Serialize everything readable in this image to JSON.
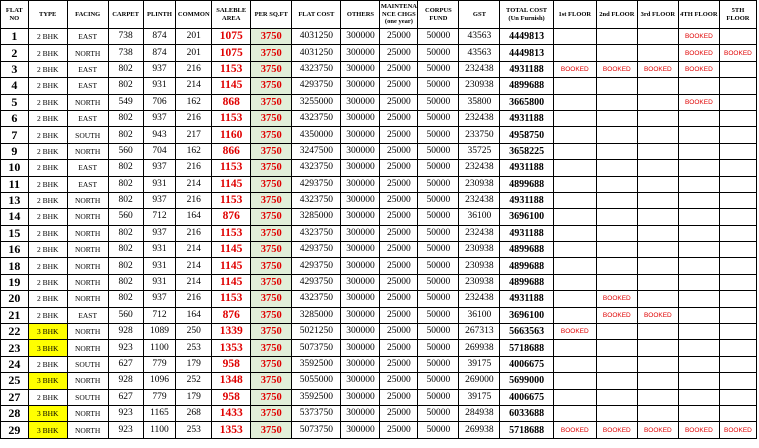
{
  "headers": [
    "FLAT NO",
    "TYPE",
    "FACING",
    "CARPET",
    "PLINTH",
    "COMMON",
    "SALEBLE AREA",
    "PER SQ.FT",
    "FLAT COST",
    "OTHERS",
    "MAINTENA NCE CHGS (one year)",
    "CORPUS FUND",
    "GST",
    "TOTAL COST (Un Furnish)",
    "1st FLOOR",
    "2nd FLOOR",
    "3rd FLOOR",
    "4TH FLOOR",
    "5TH FLOOR"
  ],
  "booked_label": "BOOKED",
  "highlight_color": "#ffff00",
  "rate_column_color": "#e2efd9",
  "accent_red": "#e00000",
  "rows": [
    {
      "flat": "1",
      "type": "2 BHK",
      "facing": "EAST",
      "carpet": "738",
      "plinth": "874",
      "common": "201",
      "saleable": "1075",
      "rate": "3750",
      "flat_cost": "4031250",
      "others": "300000",
      "maint": "25000",
      "corpus": "50000",
      "gst": "43563",
      "total": "4449813",
      "floors": [
        "",
        "",
        "",
        "BOOKED",
        ""
      ]
    },
    {
      "flat": "2",
      "type": "2 BHK",
      "facing": "NORTH",
      "carpet": "738",
      "plinth": "874",
      "common": "201",
      "saleable": "1075",
      "rate": "3750",
      "flat_cost": "4031250",
      "others": "300000",
      "maint": "25000",
      "corpus": "50000",
      "gst": "43563",
      "total": "4449813",
      "floors": [
        "",
        "",
        "",
        "BOOKED",
        "BOOKED"
      ]
    },
    {
      "flat": "3",
      "type": "2 BHK",
      "facing": "EAST",
      "carpet": "802",
      "plinth": "937",
      "common": "216",
      "saleable": "1153",
      "rate": "3750",
      "flat_cost": "4323750",
      "others": "300000",
      "maint": "25000",
      "corpus": "50000",
      "gst": "232438",
      "total": "4931188",
      "floors": [
        "BOOKED",
        "BOOKED",
        "BOOKED",
        "BOOKED",
        ""
      ]
    },
    {
      "flat": "4",
      "type": "2 BHK",
      "facing": "EAST",
      "carpet": "802",
      "plinth": "931",
      "common": "214",
      "saleable": "1145",
      "rate": "3750",
      "flat_cost": "4293750",
      "others": "300000",
      "maint": "25000",
      "corpus": "50000",
      "gst": "230938",
      "total": "4899688",
      "floors": [
        "",
        "",
        "",
        "",
        ""
      ]
    },
    {
      "flat": "5",
      "type": "2 BHK",
      "facing": "NORTH",
      "carpet": "549",
      "plinth": "706",
      "common": "162",
      "saleable": "868",
      "rate": "3750",
      "flat_cost": "3255000",
      "others": "300000",
      "maint": "25000",
      "corpus": "50000",
      "gst": "35800",
      "total": "3665800",
      "floors": [
        "",
        "",
        "",
        "BOOKED",
        ""
      ]
    },
    {
      "flat": "6",
      "type": "2 BHK",
      "facing": "EAST",
      "carpet": "802",
      "plinth": "937",
      "common": "216",
      "saleable": "1153",
      "rate": "3750",
      "flat_cost": "4323750",
      "others": "300000",
      "maint": "25000",
      "corpus": "50000",
      "gst": "232438",
      "total": "4931188",
      "floors": [
        "",
        "",
        "",
        "",
        ""
      ]
    },
    {
      "flat": "7",
      "type": "2 BHK",
      "facing": "SOUTH",
      "carpet": "802",
      "plinth": "943",
      "common": "217",
      "saleable": "1160",
      "rate": "3750",
      "flat_cost": "4350000",
      "others": "300000",
      "maint": "25000",
      "corpus": "50000",
      "gst": "233750",
      "total": "4958750",
      "floors": [
        "",
        "",
        "",
        "",
        ""
      ]
    },
    {
      "flat": "9",
      "type": "2 BHK",
      "facing": "NORTH",
      "carpet": "560",
      "plinth": "704",
      "common": "162",
      "saleable": "866",
      "rate": "3750",
      "flat_cost": "3247500",
      "others": "300000",
      "maint": "25000",
      "corpus": "50000",
      "gst": "35725",
      "total": "3658225",
      "floors": [
        "",
        "",
        "",
        "",
        ""
      ]
    },
    {
      "flat": "10",
      "type": "2 BHK",
      "facing": "EAST",
      "carpet": "802",
      "plinth": "937",
      "common": "216",
      "saleable": "1153",
      "rate": "3750",
      "flat_cost": "4323750",
      "others": "300000",
      "maint": "25000",
      "corpus": "50000",
      "gst": "232438",
      "total": "4931188",
      "floors": [
        "",
        "",
        "",
        "",
        ""
      ]
    },
    {
      "flat": "11",
      "type": "2 BHK",
      "facing": "EAST",
      "carpet": "802",
      "plinth": "931",
      "common": "214",
      "saleable": "1145",
      "rate": "3750",
      "flat_cost": "4293750",
      "others": "300000",
      "maint": "25000",
      "corpus": "50000",
      "gst": "230938",
      "total": "4899688",
      "floors": [
        "",
        "",
        "",
        "",
        ""
      ]
    },
    {
      "flat": "13",
      "type": "2 BHK",
      "facing": "NORTH",
      "carpet": "802",
      "plinth": "937",
      "common": "216",
      "saleable": "1153",
      "rate": "3750",
      "flat_cost": "4323750",
      "others": "300000",
      "maint": "25000",
      "corpus": "50000",
      "gst": "232438",
      "total": "4931188",
      "floors": [
        "",
        "",
        "",
        "",
        ""
      ]
    },
    {
      "flat": "14",
      "type": "2 BHK",
      "facing": "NORTH",
      "carpet": "560",
      "plinth": "712",
      "common": "164",
      "saleable": "876",
      "rate": "3750",
      "flat_cost": "3285000",
      "others": "300000",
      "maint": "25000",
      "corpus": "50000",
      "gst": "36100",
      "total": "3696100",
      "floors": [
        "",
        "",
        "",
        "",
        ""
      ]
    },
    {
      "flat": "15",
      "type": "2 BHK",
      "facing": "NORTH",
      "carpet": "802",
      "plinth": "937",
      "common": "216",
      "saleable": "1153",
      "rate": "3750",
      "flat_cost": "4323750",
      "others": "300000",
      "maint": "25000",
      "corpus": "50000",
      "gst": "232438",
      "total": "4931188",
      "floors": [
        "",
        "",
        "",
        "",
        ""
      ]
    },
    {
      "flat": "16",
      "type": "2 BHK",
      "facing": "NORTH",
      "carpet": "802",
      "plinth": "931",
      "common": "214",
      "saleable": "1145",
      "rate": "3750",
      "flat_cost": "4293750",
      "others": "300000",
      "maint": "25000",
      "corpus": "50000",
      "gst": "230938",
      "total": "4899688",
      "floors": [
        "",
        "",
        "",
        "",
        ""
      ]
    },
    {
      "flat": "18",
      "type": "2 BHK",
      "facing": "NORTH",
      "carpet": "802",
      "plinth": "931",
      "common": "214",
      "saleable": "1145",
      "rate": "3750",
      "flat_cost": "4293750",
      "others": "300000",
      "maint": "25000",
      "corpus": "50000",
      "gst": "230938",
      "total": "4899688",
      "floors": [
        "",
        "",
        "",
        "",
        ""
      ]
    },
    {
      "flat": "19",
      "type": "2 BHK",
      "facing": "NORTH",
      "carpet": "802",
      "plinth": "931",
      "common": "214",
      "saleable": "1145",
      "rate": "3750",
      "flat_cost": "4293750",
      "others": "300000",
      "maint": "25000",
      "corpus": "50000",
      "gst": "230938",
      "total": "4899688",
      "floors": [
        "",
        "",
        "",
        "",
        ""
      ]
    },
    {
      "flat": "20",
      "type": "2 BHK",
      "facing": "NORTH",
      "carpet": "802",
      "plinth": "937",
      "common": "216",
      "saleable": "1153",
      "rate": "3750",
      "flat_cost": "4323750",
      "others": "300000",
      "maint": "25000",
      "corpus": "50000",
      "gst": "232438",
      "total": "4931188",
      "floors": [
        "",
        "BOOKED",
        "",
        "",
        ""
      ]
    },
    {
      "flat": "21",
      "type": "2 BHK",
      "facing": "EAST",
      "carpet": "560",
      "plinth": "712",
      "common": "164",
      "saleable": "876",
      "rate": "3750",
      "flat_cost": "3285000",
      "others": "300000",
      "maint": "25000",
      "corpus": "50000",
      "gst": "36100",
      "total": "3696100",
      "floors": [
        "",
        "BOOKED",
        "BOOKED",
        "",
        ""
      ]
    },
    {
      "flat": "22",
      "type": "3 BHK",
      "facing": "NORTH",
      "carpet": "928",
      "plinth": "1089",
      "common": "250",
      "saleable": "1339",
      "rate": "3750",
      "flat_cost": "5021250",
      "others": "300000",
      "maint": "25000",
      "corpus": "50000",
      "gst": "267313",
      "total": "5663563",
      "floors": [
        "BOOKED",
        "",
        "",
        "",
        ""
      ]
    },
    {
      "flat": "23",
      "type": "3 BHK",
      "facing": "NORTH",
      "carpet": "923",
      "plinth": "1100",
      "common": "253",
      "saleable": "1353",
      "rate": "3750",
      "flat_cost": "5073750",
      "others": "300000",
      "maint": "25000",
      "corpus": "50000",
      "gst": "269938",
      "total": "5718688",
      "floors": [
        "",
        "",
        "",
        "",
        ""
      ]
    },
    {
      "flat": "24",
      "type": "2 BHK",
      "facing": "SOUTH",
      "carpet": "627",
      "plinth": "779",
      "common": "179",
      "saleable": "958",
      "rate": "3750",
      "flat_cost": "3592500",
      "others": "300000",
      "maint": "25000",
      "corpus": "50000",
      "gst": "39175",
      "total": "4006675",
      "floors": [
        "",
        "",
        "",
        "",
        ""
      ]
    },
    {
      "flat": "25",
      "type": "3 BHK",
      "facing": "NORTH",
      "carpet": "928",
      "plinth": "1096",
      "common": "252",
      "saleable": "1348",
      "rate": "3750",
      "flat_cost": "5055000",
      "others": "300000",
      "maint": "25000",
      "corpus": "50000",
      "gst": "269000",
      "total": "5699000",
      "floors": [
        "",
        "",
        "",
        "",
        ""
      ]
    },
    {
      "flat": "27",
      "type": "2 BHK",
      "facing": "SOUTH",
      "carpet": "627",
      "plinth": "779",
      "common": "179",
      "saleable": "958",
      "rate": "3750",
      "flat_cost": "3592500",
      "others": "300000",
      "maint": "25000",
      "corpus": "50000",
      "gst": "39175",
      "total": "4006675",
      "floors": [
        "",
        "",
        "",
        "",
        ""
      ]
    },
    {
      "flat": "28",
      "type": "3 BHK",
      "facing": "NORTH",
      "carpet": "923",
      "plinth": "1165",
      "common": "268",
      "saleable": "1433",
      "rate": "3750",
      "flat_cost": "5373750",
      "others": "300000",
      "maint": "25000",
      "corpus": "50000",
      "gst": "284938",
      "total": "6033688",
      "floors": [
        "",
        "",
        "",
        "",
        ""
      ]
    },
    {
      "flat": "29",
      "type": "3 BHK",
      "facing": "NORTH",
      "carpet": "923",
      "plinth": "1100",
      "common": "253",
      "saleable": "1353",
      "rate": "3750",
      "flat_cost": "5073750",
      "others": "300000",
      "maint": "25000",
      "corpus": "50000",
      "gst": "269938",
      "total": "5718688",
      "floors": [
        "BOOKED",
        "BOOKED",
        "BOOKED",
        "BOOKED",
        "BOOKED"
      ]
    }
  ]
}
